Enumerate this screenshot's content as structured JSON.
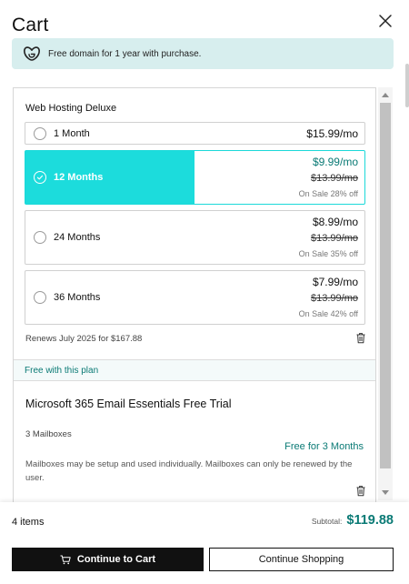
{
  "header": {
    "title": "Cart"
  },
  "promo": {
    "text": "Free domain for 1 year with purchase."
  },
  "product": {
    "name": "Web Hosting Deluxe",
    "terms": [
      {
        "label": "1 Month",
        "price": "$15.99/mo",
        "original": "",
        "sale": "",
        "selected": false
      },
      {
        "label": "12 Months",
        "price": "$9.99/mo",
        "original": "$13.99/mo",
        "sale": "On Sale 28% off",
        "selected": true
      },
      {
        "label": "24 Months",
        "price": "$8.99/mo",
        "original": "$13.99/mo",
        "sale": "On Sale 35% off",
        "selected": false
      },
      {
        "label": "36 Months",
        "price": "$7.99/mo",
        "original": "$13.99/mo",
        "sale": "On Sale 42% off",
        "selected": false
      }
    ],
    "renews": "Renews July 2025 for $167.88"
  },
  "free_plan": {
    "label": "Free with this plan"
  },
  "addon": {
    "title": "Microsoft 365 Email Essentials Free Trial",
    "mailboxes": "3 Mailboxes",
    "free_text": "Free for 3 Months",
    "description": "Mailboxes may be setup and used individually. Mailboxes can only be renewed by the user."
  },
  "footer": {
    "items_count": "4 items",
    "subtotal_label": "Subtotal:",
    "subtotal_value": "$119.88",
    "continue_cart": "Continue to Cart",
    "continue_shopping": "Continue Shopping"
  },
  "colors": {
    "accent": "#1cdcdc",
    "accent_text": "#0a7a75",
    "promo_bg": "#d7eeee"
  }
}
